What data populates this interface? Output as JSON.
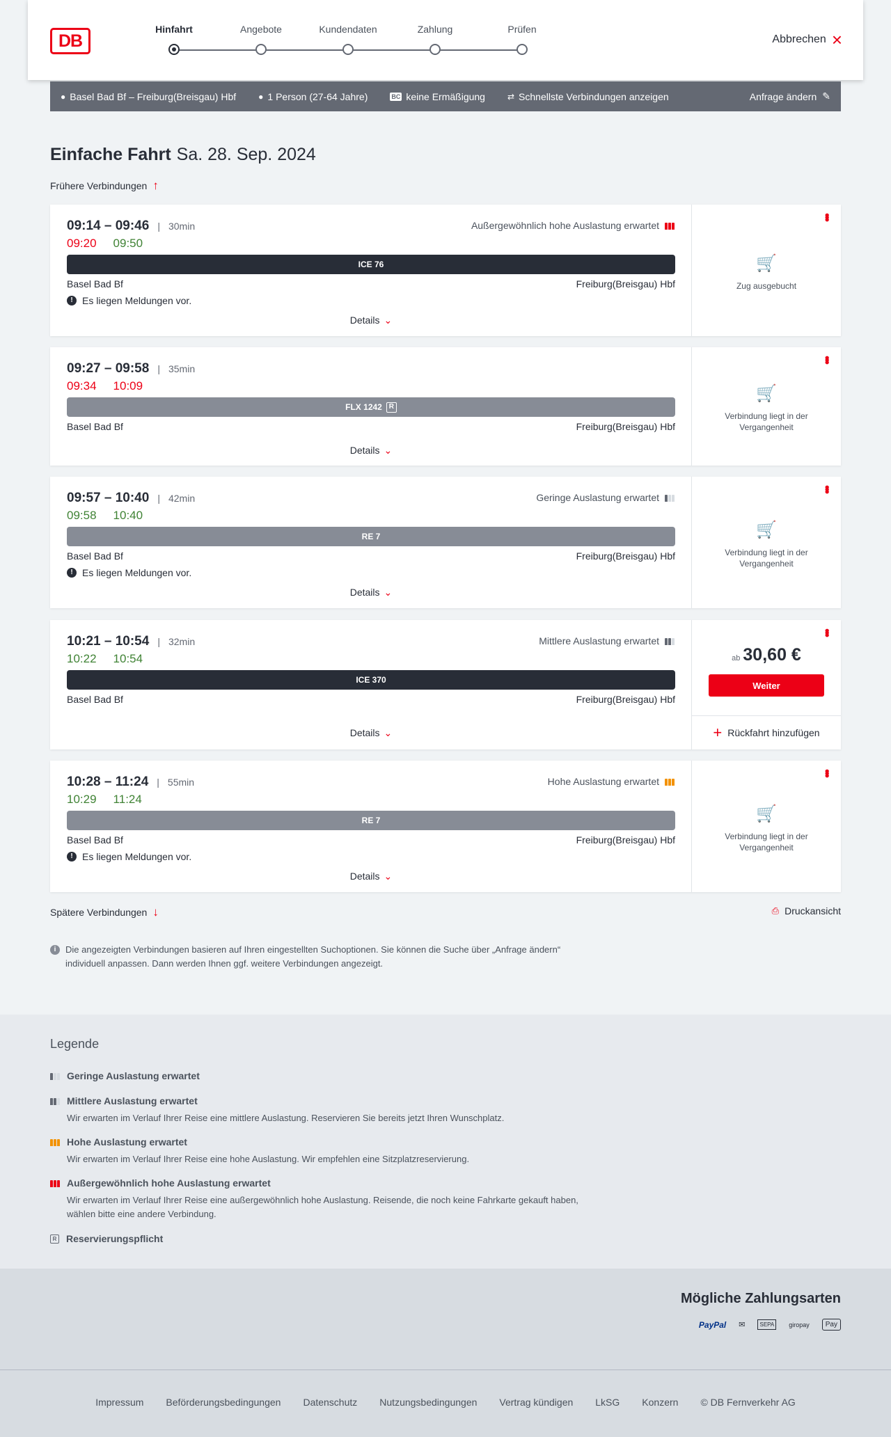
{
  "header": {
    "logo_text": "DB",
    "steps": [
      "Hinfahrt",
      "Angebote",
      "Kundendaten",
      "Zahlung",
      "Prüfen"
    ],
    "cancel_label": "Abbrechen"
  },
  "query": {
    "route": "Basel Bad Bf – Freiburg(Breisgau) Hbf",
    "persons": "1 Person (27-64 Jahre)",
    "bc_badge": "BC",
    "discount": "keine Ermäßigung",
    "fastest": "Schnellste Verbindungen anzeigen",
    "change": "Anfrage ändern"
  },
  "page": {
    "title": "Einfache Fahrt",
    "date": "Sa. 28. Sep. 2024",
    "earlier": "Frühere Verbindungen",
    "later": "Spätere Verbindungen",
    "print": "Druckansicht",
    "info_note": "Die angezeigten Verbindungen basieren auf Ihren eingestellten Suchoptionen. Sie können die Suche über „Anfrage ändern“ individuell anpassen. Dann werden Ihnen ggf. weitere Verbindungen angezeigt."
  },
  "connections": [
    {
      "times": "09:14 – 09:46",
      "duration": "30min",
      "rt_dep": "09:20",
      "rt_arr": "09:50",
      "load": "Außergewöhnlich hohe Auslastung erwartet",
      "train": "ICE 76",
      "from": "Basel Bad Bf",
      "to": "Freiburg(Breisgau) Hbf",
      "message": "Es liegen Meldungen vor.",
      "details": "Details",
      "status": "Zug ausgebucht"
    },
    {
      "times": "09:27 – 09:58",
      "duration": "35min",
      "rt_dep": "09:34",
      "rt_arr": "10:09",
      "train": "FLX 1242",
      "res_badge": "R",
      "from": "Basel Bad Bf",
      "to": "Freiburg(Breisgau) Hbf",
      "details": "Details",
      "status": "Verbindung liegt in der Vergangenheit"
    },
    {
      "times": "09:57 – 10:40",
      "duration": "42min",
      "rt_dep": "09:58",
      "rt_arr": "10:40",
      "load": "Geringe Auslastung erwartet",
      "train": "RE 7",
      "from": "Basel Bad Bf",
      "to": "Freiburg(Breisgau) Hbf",
      "message": "Es liegen Meldungen vor.",
      "details": "Details",
      "status": "Verbindung liegt in der Vergangenheit"
    },
    {
      "times": "10:21 – 10:54",
      "duration": "32min",
      "rt_dep": "10:22",
      "rt_arr": "10:54",
      "load": "Mittlere Auslastung erwartet",
      "train": "ICE 370",
      "from": "Basel Bad Bf",
      "to": "Freiburg(Breisgau) Hbf",
      "details": "Details",
      "price_prefix": "ab",
      "price": "30,60 €",
      "button": "Weiter",
      "return": "Rückfahrt hinzufügen"
    },
    {
      "times": "10:28 – 11:24",
      "duration": "55min",
      "rt_dep": "10:29",
      "rt_arr": "11:24",
      "load": "Hohe Auslastung erwartet",
      "train": "RE 7",
      "from": "Basel Bad Bf",
      "to": "Freiburg(Breisgau) Hbf",
      "message": "Es liegen Meldungen vor.",
      "details": "Details",
      "status": "Verbindung liegt in der Vergangenheit"
    }
  ],
  "legend": {
    "title": "Legende",
    "items": [
      {
        "title": "Geringe Auslastung erwartet",
        "desc": ""
      },
      {
        "title": "Mittlere Auslastung erwartet",
        "desc": "Wir erwarten im Verlauf Ihrer Reise eine mittlere Auslastung. Reservieren Sie bereits jetzt Ihren Wunschplatz."
      },
      {
        "title": "Hohe Auslastung erwartet",
        "desc": "Wir erwarten im Verlauf Ihrer Reise eine hohe Auslastung. Wir empfehlen eine Sitzplatzreservierung."
      },
      {
        "title": "Außergewöhnlich hohe Auslastung erwartet",
        "desc": "Wir erwarten im Verlauf Ihrer Reise eine außergewöhnlich hohe Auslastung. Reisende, die noch keine Fahrkarte gekauft haben, wählen bitte eine andere Verbindung."
      },
      {
        "title": "Reservierungspflicht",
        "desc": ""
      }
    ],
    "res_symbol": "R"
  },
  "payment": {
    "title": "Mögliche Zahlungsarten",
    "methods": [
      "PayPal",
      "SEPA",
      "giropay",
      "Pay"
    ]
  },
  "footer": {
    "links": [
      "Impressum",
      "Beförderungsbedingungen",
      "Datenschutz",
      "Nutzungsbedingungen",
      "Vertrag kündigen",
      "LkSG",
      "Konzern",
      "© DB Fernverkehr AG"
    ]
  },
  "colors": {
    "accent": "#ec0016",
    "dark": "#282d37",
    "grey": "#878c96",
    "ontime": "#408335",
    "high_load": "#f39200"
  }
}
